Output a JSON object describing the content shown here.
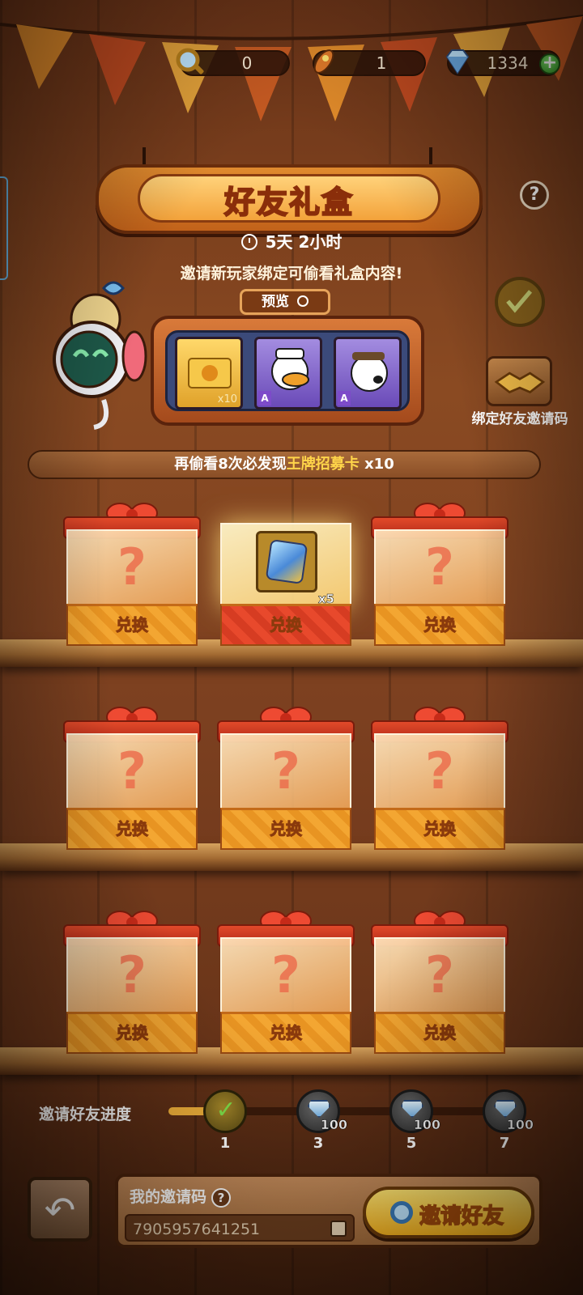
{
  "currency": {
    "magnifier": "0",
    "rocket": "1",
    "diamond": "1334"
  },
  "header": {
    "title": "好友礼盒",
    "timer": "5天 2小时"
  },
  "tip": "邀请新玩家绑定可偷看礼盒内容!",
  "preview": {
    "tag": "预览",
    "slots": [
      {
        "qty": "x10",
        "grade": ""
      },
      {
        "qty": "",
        "grade": "A"
      },
      {
        "qty": "",
        "grade": "A"
      }
    ]
  },
  "bind_button": {
    "label": "绑定好友邀请码"
  },
  "banner": {
    "prefix": "再偷看8次必发现",
    "highlight": "王牌招募卡",
    "suffix": " x10"
  },
  "boxes": [
    {
      "label": "兑换",
      "opened": false
    },
    {
      "label": "兑换",
      "opened": true,
      "reward_qty": "x5"
    },
    {
      "label": "兑换",
      "opened": false
    },
    {
      "label": "兑换",
      "opened": false
    },
    {
      "label": "兑换",
      "opened": false
    },
    {
      "label": "兑换",
      "opened": false
    },
    {
      "label": "兑换",
      "opened": false
    },
    {
      "label": "兑换",
      "opened": false
    },
    {
      "label": "兑换",
      "opened": false
    }
  ],
  "progress": {
    "label": "邀请好友进度",
    "fill_fraction": 0.14,
    "milestones": [
      {
        "step": "1",
        "reward": "",
        "done": true
      },
      {
        "step": "3",
        "reward": "100",
        "done": false
      },
      {
        "step": "5",
        "reward": "100",
        "done": false
      },
      {
        "step": "7",
        "reward": "100",
        "done": false
      }
    ]
  },
  "invite_code": {
    "title": "我的邀请码",
    "help": "?",
    "value": "7905957641251",
    "button": "邀请好友"
  },
  "help_button": "?",
  "colors": {
    "accent": "#f6b21e",
    "highlight": "#ffd54a",
    "plus": "#2b8a1e"
  }
}
